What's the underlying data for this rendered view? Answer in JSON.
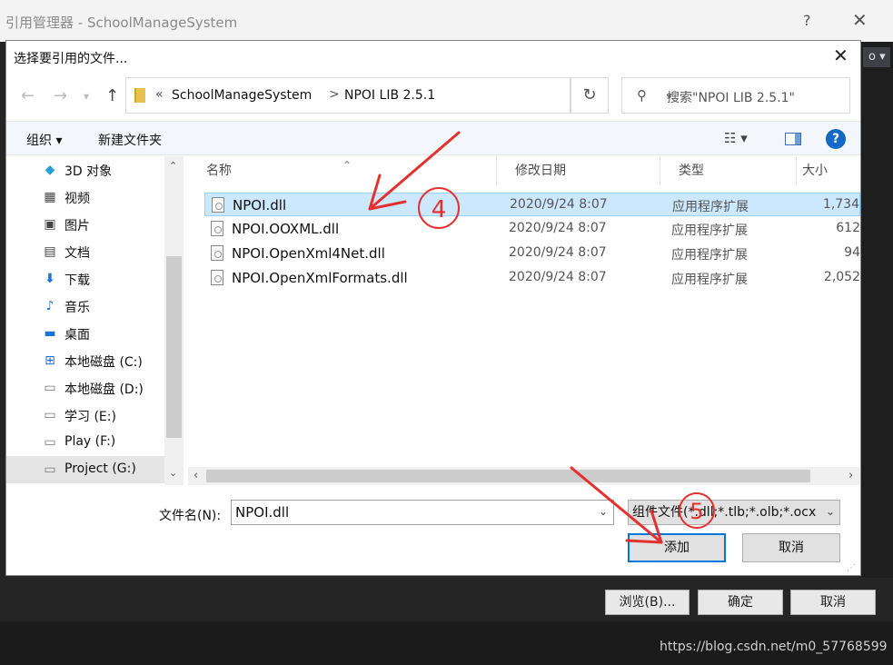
{
  "outer": {
    "title": "引用管理器 - SchoolManageSystem",
    "help": "?",
    "close": "✕",
    "side_tag": "o ▾",
    "buttons": {
      "browse": "浏览(B)...",
      "ok": "确定",
      "cancel": "取消"
    }
  },
  "dialog": {
    "title": "选择要引用的文件...",
    "close": "✕",
    "address": {
      "chevron": "«",
      "segments": [
        "SchoolManageSystem",
        "NPOI LIB 2.5.1"
      ],
      "separator": ">"
    },
    "search": {
      "placeholder": "搜索\"NPOI LIB 2.5.1\""
    },
    "toolbar": {
      "organize": "组织 ▾",
      "new_folder": "新建文件夹",
      "view": "☷ ▾",
      "help": "?"
    },
    "nav_items": [
      {
        "label": "3D 对象",
        "icon": "3d-objects-icon"
      },
      {
        "label": "视频",
        "icon": "video-icon"
      },
      {
        "label": "图片",
        "icon": "pictures-icon"
      },
      {
        "label": "文档",
        "icon": "documents-icon"
      },
      {
        "label": "下载",
        "icon": "download-icon"
      },
      {
        "label": "音乐",
        "icon": "music-icon"
      },
      {
        "label": "桌面",
        "icon": "desktop-icon"
      },
      {
        "label": "本地磁盘 (C:)",
        "icon": "windows-drive-icon"
      },
      {
        "label": "本地磁盘 (D:)",
        "icon": "drive-icon"
      },
      {
        "label": "学习 (E:)",
        "icon": "drive-icon"
      },
      {
        "label": "Play (F:)",
        "icon": "drive-icon"
      },
      {
        "label": "Project (G:)",
        "icon": "drive-icon"
      }
    ],
    "columns": [
      "名称",
      "修改日期",
      "类型",
      "大小"
    ],
    "files": [
      {
        "name": "NPOI.dll",
        "date": "2020/9/24 8:07",
        "type": "应用程序扩展",
        "size": "1,734"
      },
      {
        "name": "NPOI.OOXML.dll",
        "date": "2020/9/24 8:07",
        "type": "应用程序扩展",
        "size": "612"
      },
      {
        "name": "NPOI.OpenXml4Net.dll",
        "date": "2020/9/24 8:07",
        "type": "应用程序扩展",
        "size": "94"
      },
      {
        "name": "NPOI.OpenXmlFormats.dll",
        "date": "2020/9/24 8:07",
        "type": "应用程序扩展",
        "size": "2,052"
      }
    ],
    "filename_label": "文件名(N):",
    "filename_value": "NPOI.dll",
    "filter": "组件文件(*.dll;*.tlb;*.olb;*.ocx",
    "add_button": "添加",
    "cancel_button": "取消"
  },
  "annotations": {
    "step4": "4",
    "step5": "5",
    "color": "#e53030"
  },
  "watermark": "https://blog.csdn.net/m0_57768599"
}
